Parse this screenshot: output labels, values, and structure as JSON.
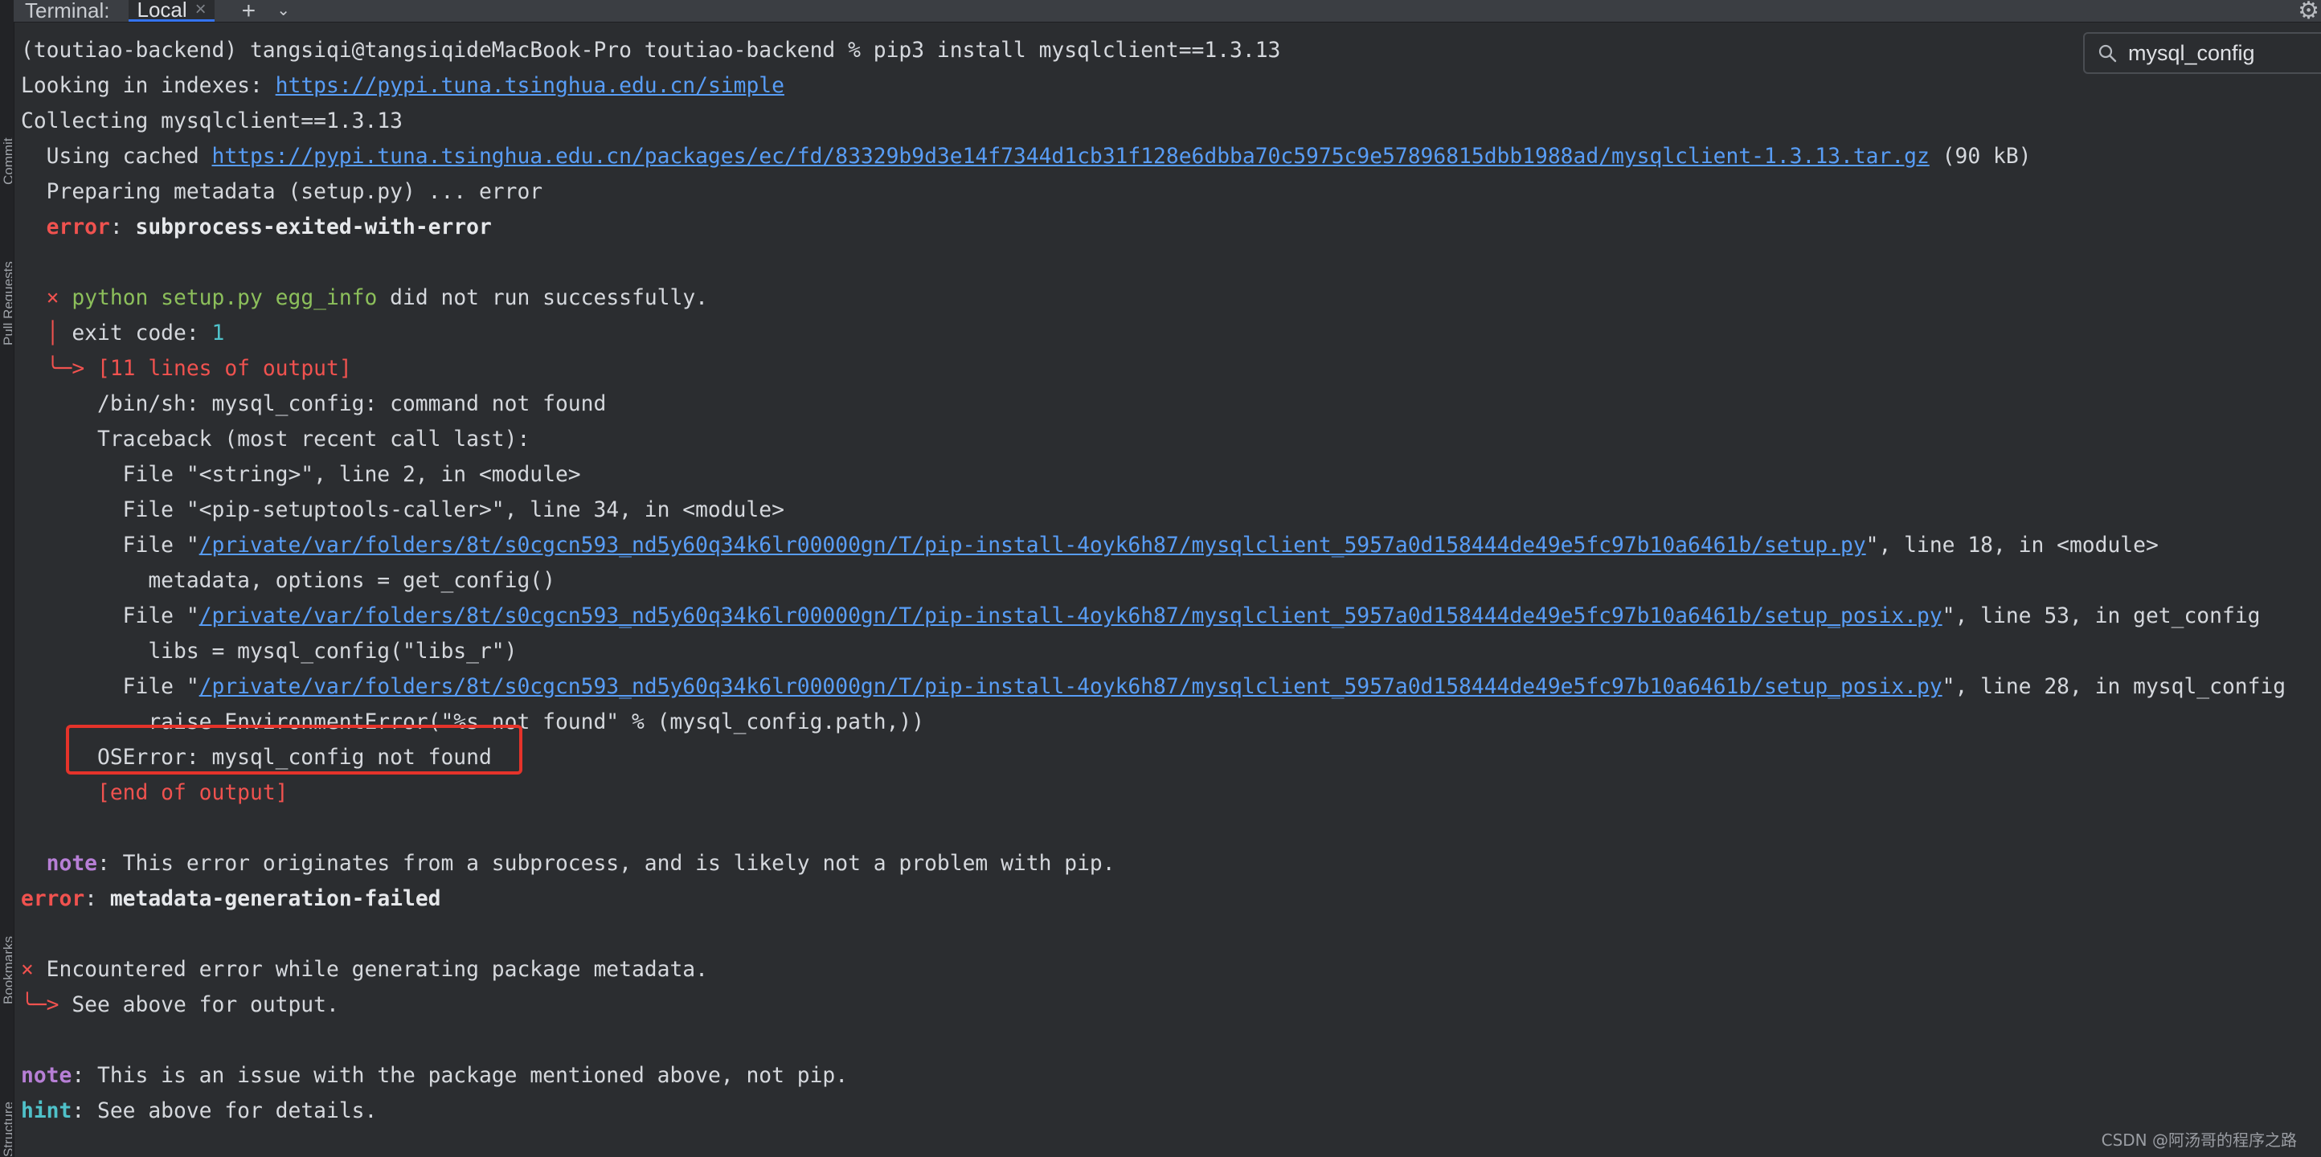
{
  "side_strip": {
    "labels": [
      "Commit",
      "Pull Requests",
      "Bookmarks",
      "Structure"
    ]
  },
  "tabbar": {
    "title": "Terminal:",
    "tab_label": "Local",
    "close_glyph": "×",
    "new_tab_glyph": "+",
    "dropdown_glyph": "⌄",
    "settings_glyph": "⚙"
  },
  "search": {
    "value": "mysql_config"
  },
  "terminal": {
    "lines": [
      [
        {
          "t": "(toutiao-backend) tangsiqi@tangsiqideMacBook-Pro toutiao-backend % pip3 install mysqlclient==1.3.13"
        }
      ],
      [
        {
          "t": "Looking in indexes: "
        },
        {
          "t": "https://pypi.tuna.tsinghua.edu.cn/simple",
          "c": "link"
        }
      ],
      [
        {
          "t": "Collecting mysqlclient==1.3.13"
        }
      ],
      [
        {
          "t": "  Using cached "
        },
        {
          "t": "https://pypi.tuna.tsinghua.edu.cn/packages/ec/fd/83329b9d3e14f7344d1cb31f128e6dbba70c5975c9e57896815dbb1988ad/mysqlclient-1.3.13.tar.gz",
          "c": "link"
        },
        {
          "t": " (90 kB)"
        }
      ],
      [
        {
          "t": "  Preparing metadata (setup.py) ... error"
        }
      ],
      [
        {
          "t": "  "
        },
        {
          "t": "error",
          "c": "err bold-err"
        },
        {
          "t": ": "
        },
        {
          "t": "subprocess-exited-with-error",
          "c": "bold"
        }
      ],
      [
        {
          "t": ""
        }
      ],
      [
        {
          "t": "  "
        },
        {
          "t": "×",
          "c": "err"
        },
        {
          "t": " "
        },
        {
          "t": "python setup.py egg_info",
          "c": "green"
        },
        {
          "t": " did not run successfully."
        }
      ],
      [
        {
          "t": "  "
        },
        {
          "t": "│",
          "c": "err"
        },
        {
          "t": " exit code: "
        },
        {
          "t": "1",
          "c": "cyan"
        }
      ],
      [
        {
          "t": "  "
        },
        {
          "t": "╰─>",
          "c": "err"
        },
        {
          "t": " "
        },
        {
          "t": "[11 lines of output]",
          "c": "err"
        }
      ],
      [
        {
          "t": "      /bin/sh: mysql_config: command not found"
        }
      ],
      [
        {
          "t": "      Traceback (most recent call last):"
        }
      ],
      [
        {
          "t": "        File \"<string>\", line 2, in <module>"
        }
      ],
      [
        {
          "t": "        File \"<pip-setuptools-caller>\", line 34, in <module>"
        }
      ],
      [
        {
          "t": "        File \""
        },
        {
          "t": "/private/var/folders/8t/s0cgcn593_nd5y60q34k6lr00000gn/T/pip-install-4oyk6h87/mysqlclient_5957a0d158444de49e5fc97b10a6461b/setup.py",
          "c": "link"
        },
        {
          "t": "\", line 18, in <module>"
        }
      ],
      [
        {
          "t": "          metadata, options = get_config()"
        }
      ],
      [
        {
          "t": "        File \""
        },
        {
          "t": "/private/var/folders/8t/s0cgcn593_nd5y60q34k6lr00000gn/T/pip-install-4oyk6h87/mysqlclient_5957a0d158444de49e5fc97b10a6461b/setup_posix.py",
          "c": "link"
        },
        {
          "t": "\", line 53, in get_config"
        }
      ],
      [
        {
          "t": "          libs = mysql_config(\"libs_r\")"
        }
      ],
      [
        {
          "t": "        File \""
        },
        {
          "t": "/private/var/folders/8t/s0cgcn593_nd5y60q34k6lr00000gn/T/pip-install-4oyk6h87/mysqlclient_5957a0d158444de49e5fc97b10a6461b/setup_posix.py",
          "c": "link"
        },
        {
          "t": "\", line 28, in mysql_config"
        }
      ],
      [
        {
          "t": "          raise EnvironmentError(\"%s not found\" % (mysql_config.path,))"
        }
      ],
      [
        {
          "t": "      OSError: mysql_config not found"
        }
      ],
      [
        {
          "t": "      "
        },
        {
          "t": "[end of output]",
          "c": "err"
        }
      ],
      [
        {
          "t": ""
        }
      ],
      [
        {
          "t": "  "
        },
        {
          "t": "note",
          "c": "note"
        },
        {
          "t": ": This error originates from a subprocess, and is likely not a problem with pip."
        }
      ],
      [
        {
          "t": "error",
          "c": "err bold-err"
        },
        {
          "t": ": "
        },
        {
          "t": "metadata-generation-failed",
          "c": "bold"
        }
      ],
      [
        {
          "t": ""
        }
      ],
      [
        {
          "t": "×",
          "c": "err"
        },
        {
          "t": " Encountered error while generating package metadata."
        }
      ],
      [
        {
          "t": "╰─>",
          "c": "err"
        },
        {
          "t": " See above for output."
        }
      ],
      [
        {
          "t": ""
        }
      ],
      [
        {
          "t": "note",
          "c": "note"
        },
        {
          "t": ": This is an issue with the package mentioned above, not pip."
        }
      ],
      [
        {
          "t": "hint",
          "c": "hint"
        },
        {
          "t": ": See above for details."
        }
      ]
    ]
  },
  "watermark": "CSDN @阿汤哥的程序之路",
  "colors": {
    "background": "#2b2d30",
    "error": "#f0524f",
    "link": "#589df6",
    "note": "#b77fd6",
    "hint": "#4fc1c9",
    "highlight_box": "#e5332a"
  }
}
